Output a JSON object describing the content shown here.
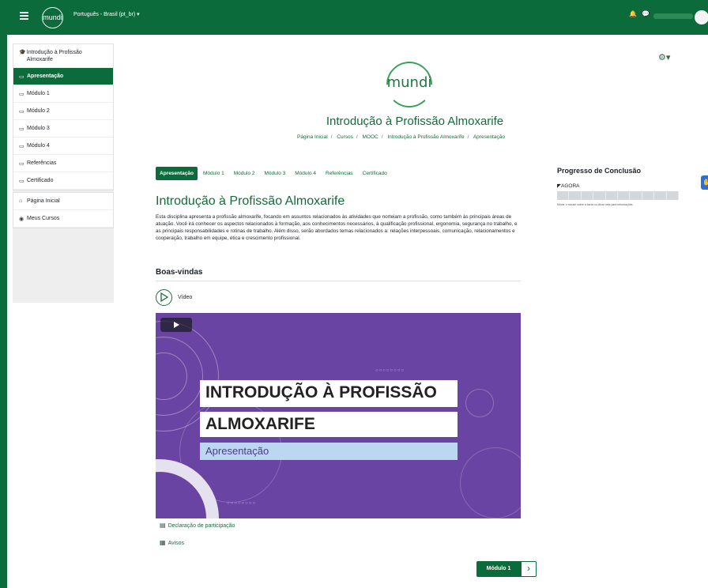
{
  "navbar": {
    "logo_text": "mundi",
    "language_menu": "Português - Brasil (pt_br) ▾",
    "bell_icon": "bell-icon",
    "chat_icon": "chat-icon"
  },
  "drawer": {
    "items": [
      {
        "label": "Introdução à Profissão Almoxarife",
        "icon": "graduation-cap-icon"
      },
      {
        "label": "Apresentação",
        "icon": "folder-icon",
        "active": true
      },
      {
        "label": "Módulo 1",
        "icon": "folder-icon"
      },
      {
        "label": "Módulo 2",
        "icon": "folder-icon"
      },
      {
        "label": "Módulo 3",
        "icon": "folder-icon"
      },
      {
        "label": "Módulo 4",
        "icon": "folder-icon"
      },
      {
        "label": "Referências",
        "icon": "folder-icon"
      },
      {
        "label": "Certificado",
        "icon": "folder-icon"
      }
    ],
    "items2": [
      {
        "label": "Página Inicial",
        "icon": "home-icon"
      },
      {
        "label": "Meus Cursos",
        "icon": "dashboard-icon"
      }
    ]
  },
  "header": {
    "logo_text": "mundi",
    "course_title": "Introdução à Profissão Almoxarife",
    "breadcrumb": [
      "Página Inicial",
      "Cursos",
      "MOOC",
      "Introdução à Profissão Almoxarife",
      "Apresentação"
    ]
  },
  "tabs": [
    "Apresentação",
    "Módulo 1",
    "Módulo 2",
    "Módulo 3",
    "Módulo 4",
    "Referências",
    "Certificado"
  ],
  "main": {
    "title": "Introdução à Profissão Almoxarife",
    "description": "Esta disciplina apresenta a profissão almoxarife, focando em assuntos relacionados às atividades que norteiam a profissão, como também às principais áreas de atuação. Você irá conhecer os aspectos relacionados à formação, aos conhecimentos necessários, à qualificação profissional, ergonomia, segurança no trabalho, e as principais responsabilidades e rotinas de trabalho. Além disso, serão abordados temas relacionados a: relações interpessoais, comunicação, relacionamentos e cooperação, trabalho em equipe, ética e crescimento profissional.",
    "section_title": "Boas-vindas",
    "video_label": "Vídeo",
    "video": {
      "line1": "INTRODUÇÃO À PROFISSÃO",
      "line2": "ALMOXARIFE",
      "line3": "Apresentação"
    },
    "links": [
      {
        "label": "Declaração de participação",
        "icon": "certificate-icon"
      },
      {
        "label": "Avisos",
        "icon": "forum-icon"
      }
    ],
    "next_button": "Módulo 1"
  },
  "progress": {
    "title": "Progresso de Conclusão",
    "now_label": "AGORA",
    "hint": "Mover o mouse sobre a barra ou clicar nela para informações"
  },
  "colors": {
    "primary": "#0c6b3a",
    "video_bg": "#6a44a2",
    "subtitle_band": "#bcd8f1"
  }
}
